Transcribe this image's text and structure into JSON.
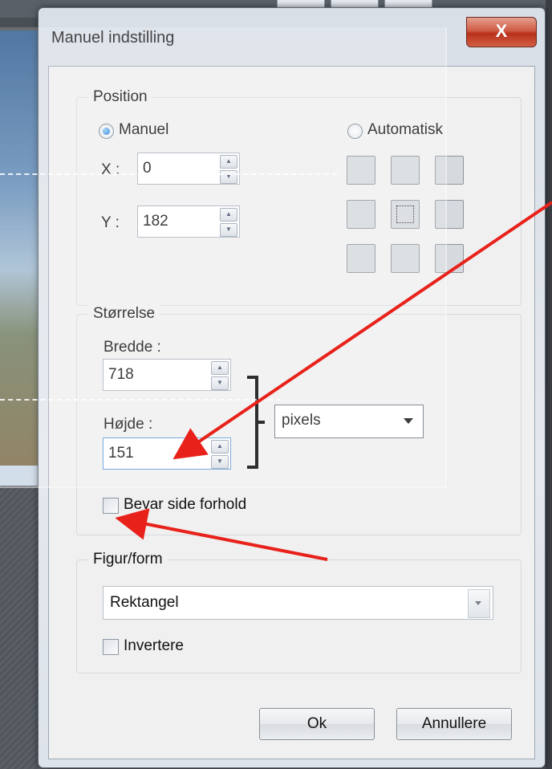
{
  "dialog": {
    "title": "Manuel indstilling",
    "close_label": "X"
  },
  "position": {
    "group_label": "Position",
    "manual_label": "Manuel",
    "manual_selected": true,
    "auto_label": "Automatisk",
    "auto_selected": false,
    "x_label": "X :",
    "x_value": "0",
    "y_label": "Y :",
    "y_value": "182",
    "anchor_grid_selected": "center"
  },
  "size": {
    "group_label": "Størrelse",
    "width_label": "Bredde :",
    "width_value": "718",
    "height_label": "Højde :",
    "height_value": "151",
    "unit_value": "pixels",
    "keep_ratio_label": "Bevar side forhold",
    "keep_ratio_checked": false
  },
  "shape": {
    "group_label": "Figur/form",
    "shape_value": "Rektangel",
    "invert_label": "Invertere",
    "invert_checked": false
  },
  "buttons": {
    "ok_label": "Ok",
    "cancel_label": "Annullere"
  },
  "annotation": {
    "arrow_color": "#e8221b"
  }
}
